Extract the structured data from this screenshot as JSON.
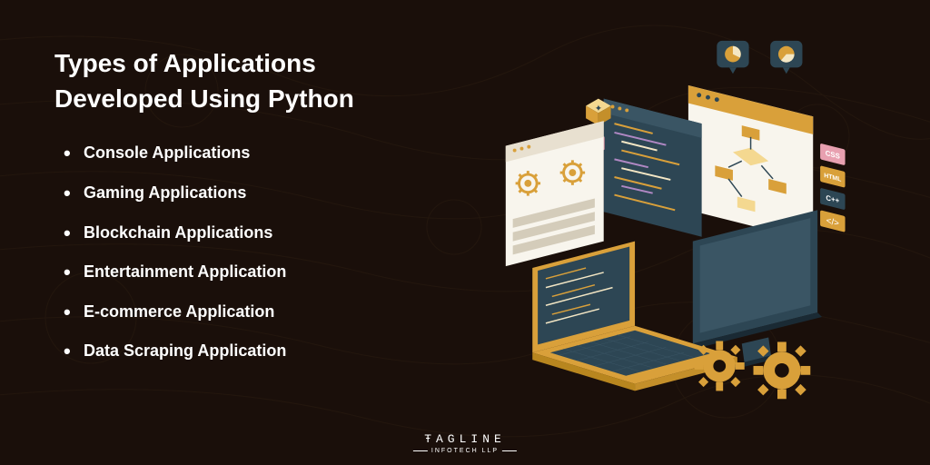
{
  "title_line1": "Types of Applications",
  "title_line2": "Developed Using Python",
  "items": [
    "Console Applications",
    "Gaming Applications",
    "Blockchain Applications",
    "Entertainment Application",
    "E-commerce Application",
    "Data Scraping Application"
  ],
  "logo": {
    "main": "ŦAGLINE",
    "sub": "INFOTECH LLP"
  },
  "colors": {
    "background": "#1a0f0a",
    "text": "#ffffff",
    "accent_gold": "#d9a03a",
    "accent_dark": "#2d4654"
  },
  "illustration_tags": [
    "CSS",
    "HTML",
    "C++"
  ]
}
